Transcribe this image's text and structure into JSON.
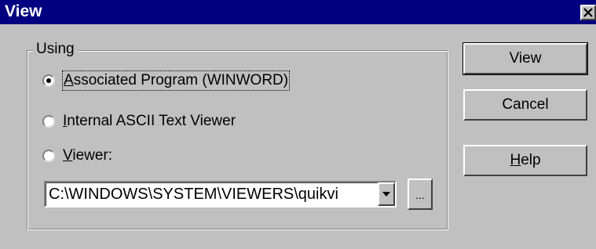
{
  "window": {
    "title": "View"
  },
  "group": {
    "label": "Using"
  },
  "options": [
    {
      "label": "Associated Program (WINWORD)",
      "selected": true,
      "mnemonic": "A"
    },
    {
      "label": "Internal ASCII Text Viewer",
      "selected": false,
      "mnemonic": "I"
    },
    {
      "label": "Viewer:",
      "selected": false,
      "mnemonic": "V"
    }
  ],
  "viewer_path": {
    "value": "C:\\WINDOWS\\SYSTEM\\VIEWERS\\quikvi"
  },
  "browse_button": {
    "label": "..."
  },
  "buttons": {
    "view": "View",
    "cancel": "Cancel",
    "help": "Help"
  }
}
